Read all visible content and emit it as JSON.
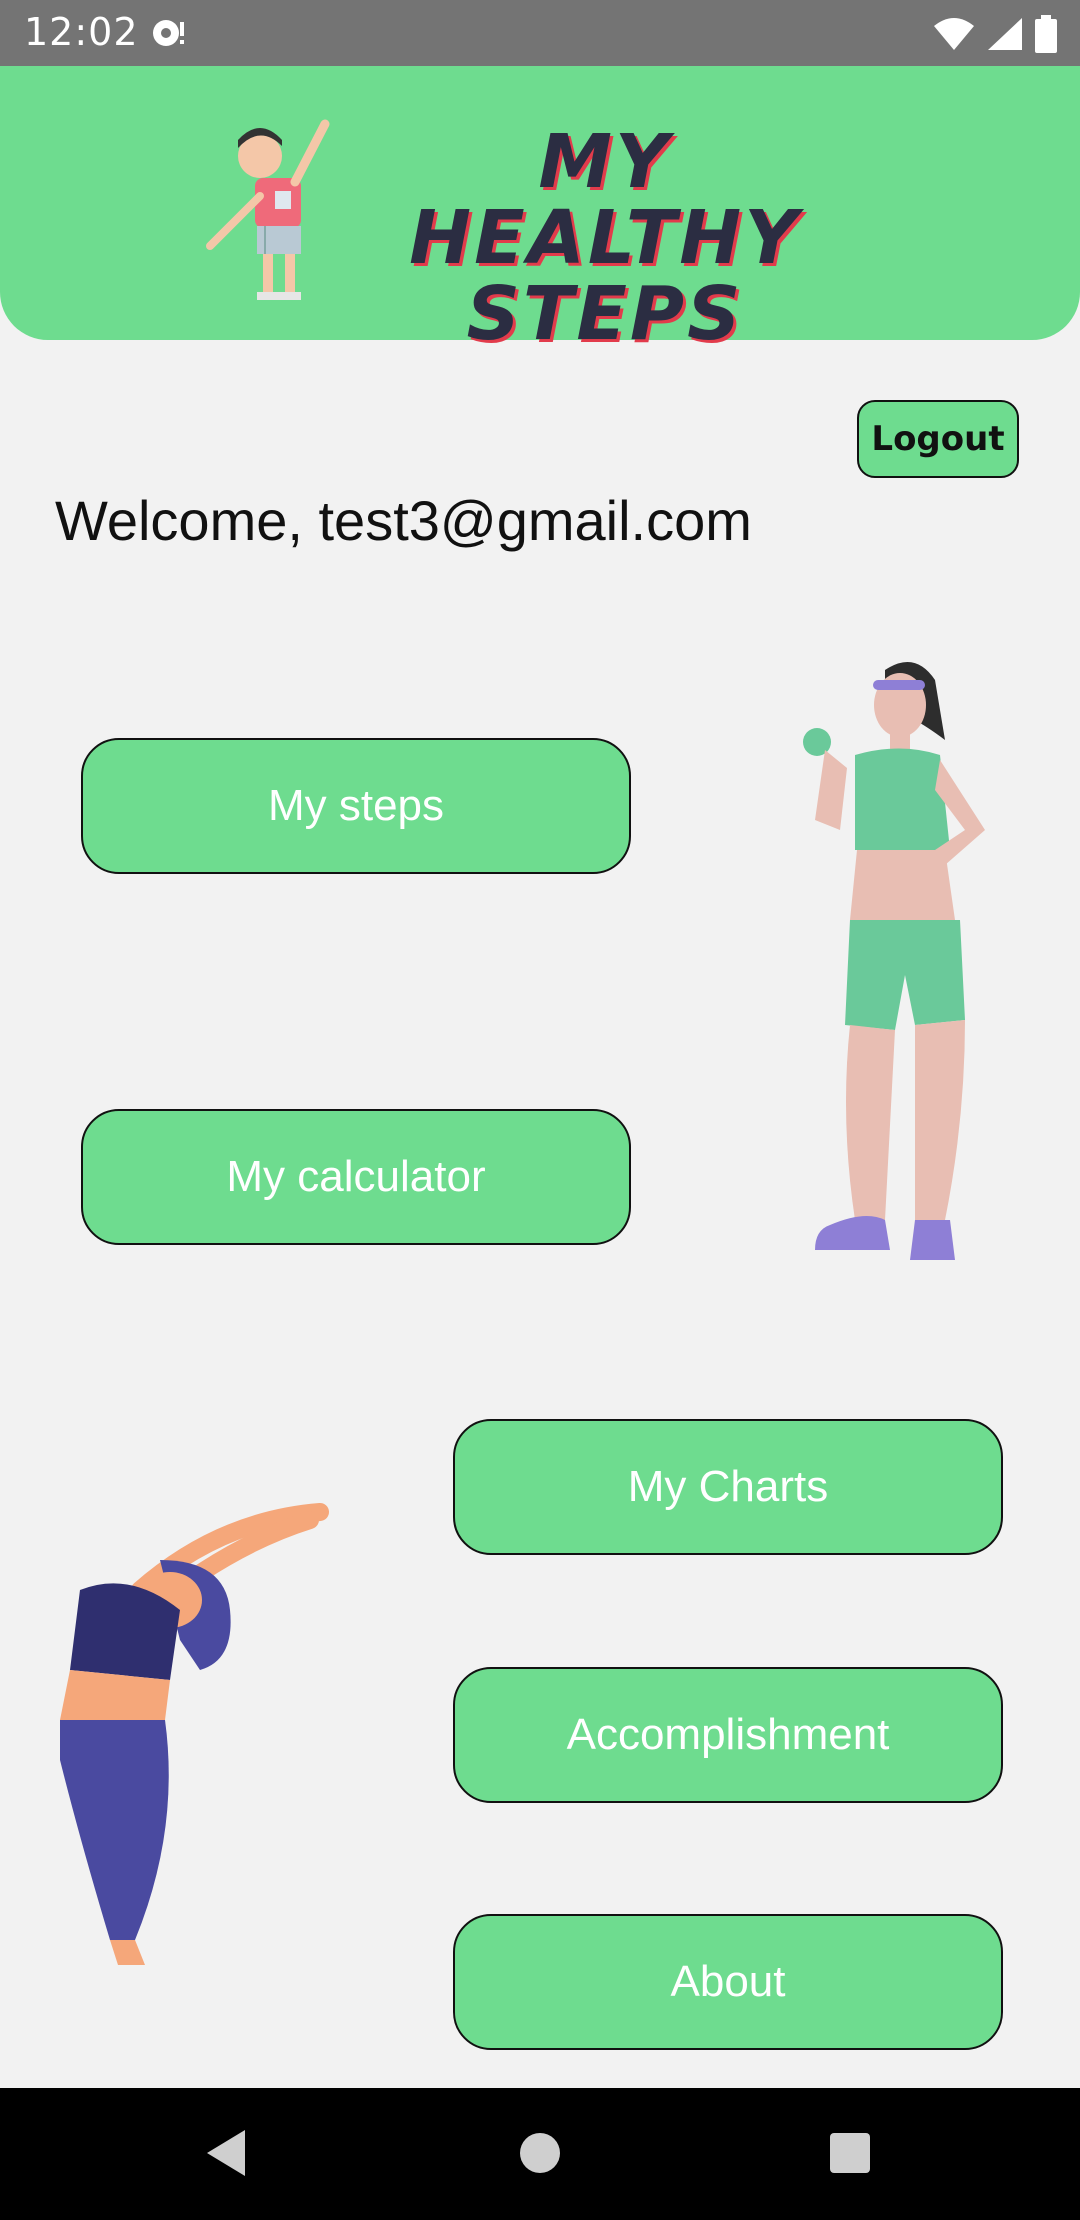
{
  "status_bar": {
    "time": "12:02",
    "icons": [
      "notification-icon",
      "wifi-icon",
      "signal-icon",
      "battery-icon"
    ]
  },
  "header": {
    "logo_line1": "MY HEALTHY",
    "logo_line2": "STEPS"
  },
  "logout_label": "Logout",
  "welcome_text": "Welcome, test3@gmail.com",
  "menu": {
    "my_steps": "My steps",
    "my_calculator": "My calculator",
    "my_charts": "My Charts",
    "accomplishment": "Accomplishment",
    "about": "About"
  },
  "nav_bar": {
    "icons": [
      "back-icon",
      "home-icon",
      "recents-icon"
    ]
  },
  "colors": {
    "accent_green": "#6edc8f",
    "background": "#f2f2f2",
    "status_bar": "#747474",
    "logo_text": "#2b2d42",
    "logo_shadow": "#e23b4b"
  }
}
